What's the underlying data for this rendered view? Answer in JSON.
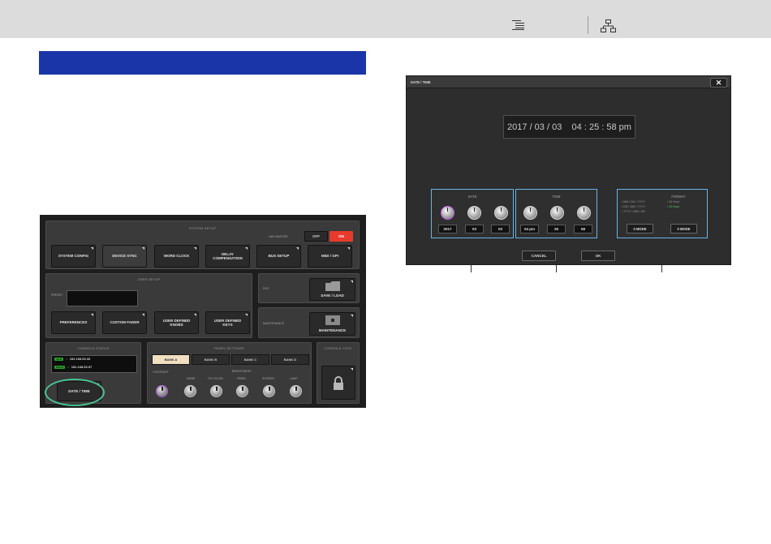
{
  "icons": {
    "toc": "toc-list-icon",
    "tree": "sitemap-tree-icon",
    "close": "close-icon",
    "lock": "lock-icon",
    "folder": "folder-icon",
    "maintenance": "maintenance-icon"
  },
  "colors": {
    "heading_bar": "#1a35a8",
    "highlight_ring": "#49c493",
    "group_border": "#6ab4e6",
    "on_button": "#e83a2c",
    "bank_selected": "#f0dfc0",
    "knob_purple": "#b055e0"
  },
  "console": {
    "system_setup": {
      "title": "SYSTEM SETUP",
      "master_label": "+48V MASTER",
      "off_label": "OFF",
      "on_label": "ON",
      "buttons": [
        "SYSTEM CONFIG",
        "DEVICE SYNC",
        "WORD CLOCK",
        "DELAY\nCOMPENSATION",
        "BUS SETUP",
        "MIDI / GPI"
      ]
    },
    "user_setup": {
      "title": "USER SETUP",
      "preset_label": "PRESET",
      "buttons": [
        "PREFERENCES",
        "CUSTOM FADER",
        "USER DEFINED\nKNOBS",
        "USER DEFINED\nKEYS"
      ]
    },
    "file": {
      "label": "FILE",
      "button": "SAVE / LOAD"
    },
    "maintenance": {
      "label": "MAINTENANCE",
      "button": "MAINTENANCE"
    },
    "console_status": {
      "title": "CONSOLE STATUS",
      "lines": [
        {
          "tag": "CS-R",
          "value": "192.168.53.33"
        },
        {
          "tag": "DSP-R",
          "value": "192.168.53.97"
        }
      ],
      "date_time_button": "DATE / TIME"
    },
    "panel_settings": {
      "title": "PANEL SETTINGS",
      "banks": [
        "BANK A",
        "BANK B",
        "BANK C",
        "BANK D"
      ],
      "contrast_label": "CONTRAST",
      "brightness_label": "BRIGHTNESS",
      "knob_labels": [
        "NAME",
        "CH COLOR",
        "PANEL",
        "SCREEN",
        "LAMP"
      ]
    },
    "console_lock": {
      "title": "CONSOLE LOCK"
    }
  },
  "dialog": {
    "title": "DATE / TIME",
    "display": "2017 / 03 / 03    04 : 25 : 58 pm",
    "date": {
      "title": "DATE",
      "values": [
        "2017",
        "03",
        "03"
      ]
    },
    "time": {
      "title": "TIME",
      "values": [
        "04 pm",
        "25",
        "58"
      ]
    },
    "format": {
      "title": "FORMAT",
      "date_formats": [
        "MM / DD / YYYY",
        "DD / MM / YYYY",
        "YYYY / MM / DD"
      ],
      "time_formats": [
        "24 Hour",
        "12 Hour"
      ],
      "mode_buttons": [
        "0 MODE",
        "0 MODE"
      ]
    },
    "cancel_label": "CANCEL",
    "ok_label": "OK"
  }
}
